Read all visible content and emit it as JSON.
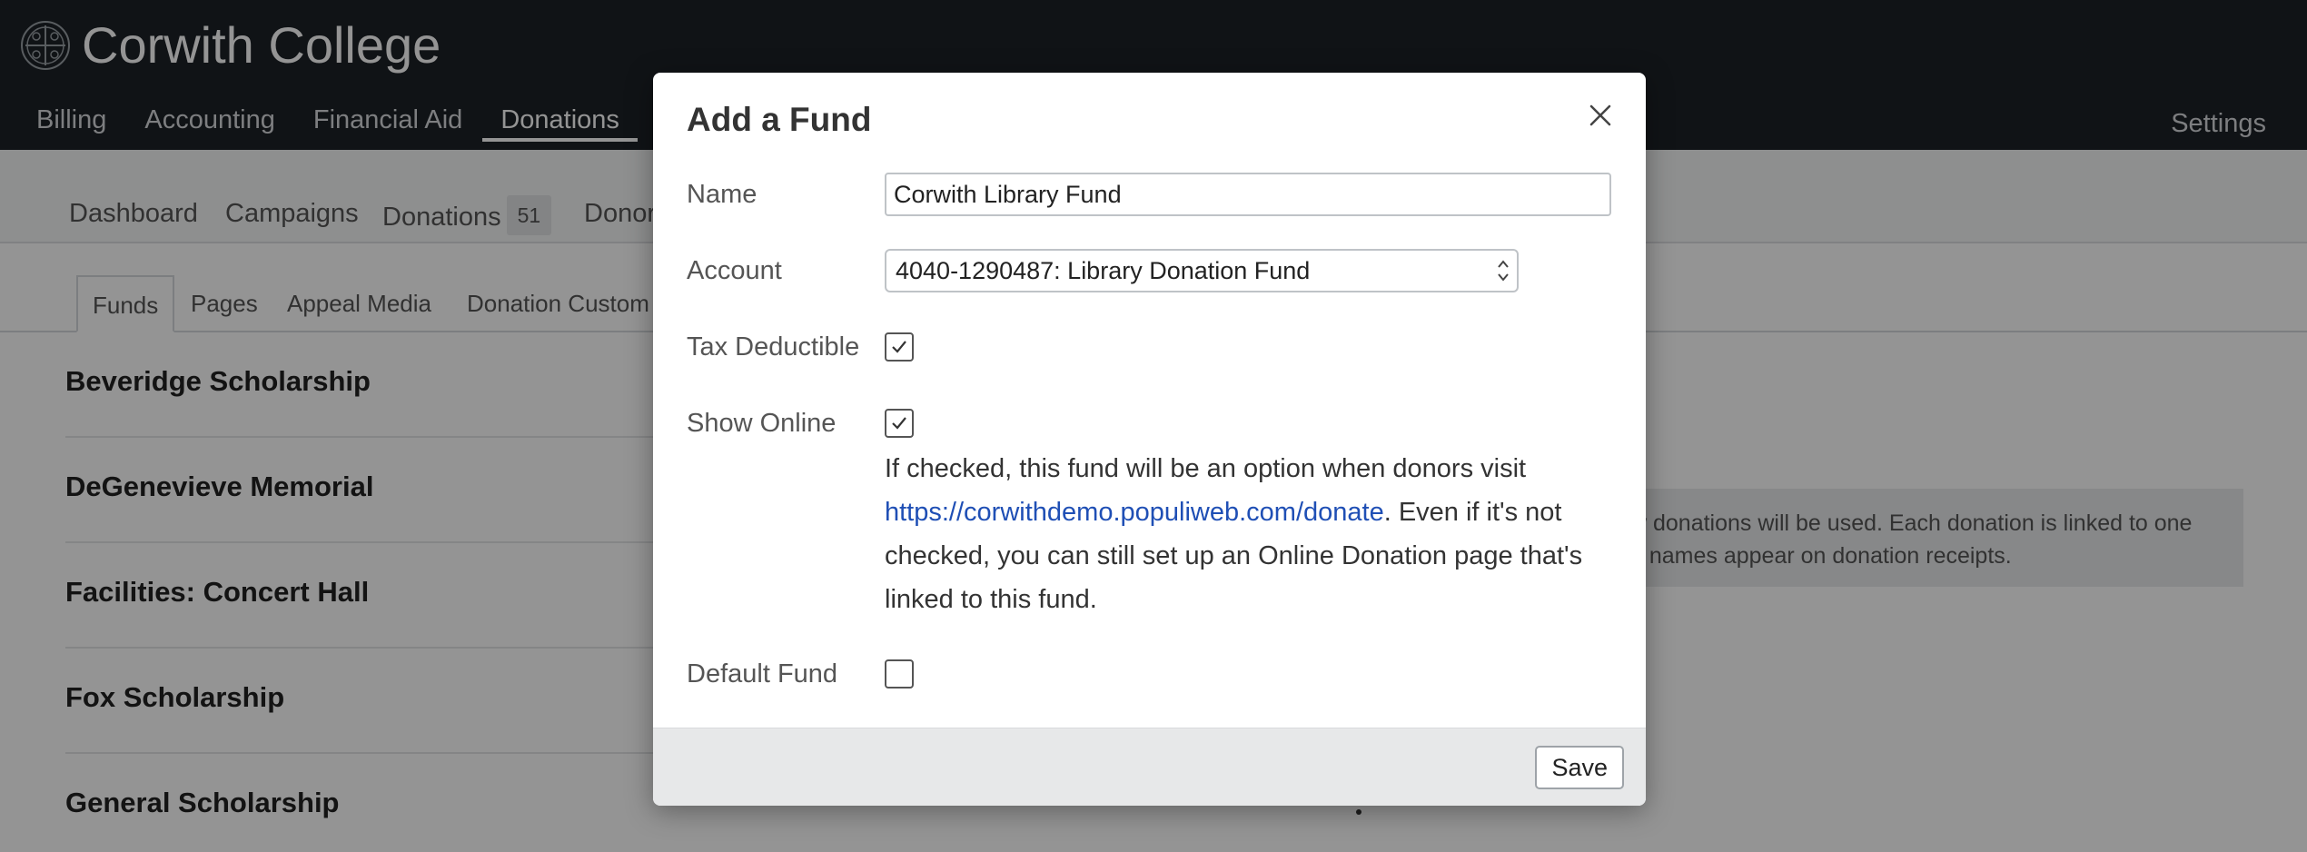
{
  "app": {
    "name": "Corwith College"
  },
  "main_nav": [
    {
      "label": "Billing"
    },
    {
      "label": "Accounting"
    },
    {
      "label": "Financial Aid"
    },
    {
      "label": "Donations"
    }
  ],
  "settings_label": "Settings",
  "sub_nav": [
    {
      "label": "Dashboard"
    },
    {
      "label": "Campaigns"
    },
    {
      "label": "Donations",
      "badge": "51"
    },
    {
      "label": "Donor"
    }
  ],
  "tabs": [
    {
      "label": "Funds"
    },
    {
      "label": "Pages"
    },
    {
      "label": "Appeal Media"
    },
    {
      "label": "Donation Custom"
    }
  ],
  "funds": [
    {
      "name": "Beveridge Scholarship"
    },
    {
      "name": "DeGenevieve Memorial"
    },
    {
      "name": "Facilities: Concert Hall"
    },
    {
      "name": "Fox Scholarship"
    },
    {
      "name": "General Scholarship"
    }
  ],
  "info_box": {
    "line1": "w donations will be used. Each donation is linked to one",
    "line2": "d names appear on donation receipts."
  },
  "modal": {
    "title": "Add a Fund",
    "name_label": "Name",
    "name_value": "Corwith Library Fund",
    "account_label": "Account",
    "account_value": "4040-1290487: Library Donation Fund",
    "tax_label": "Tax Deductible",
    "tax_checked": true,
    "online_label": "Show Online",
    "online_checked": true,
    "help_prefix": "If checked, this fund will be an option when donors visit ",
    "help_link": "https://corwithdemo.populiweb.com/donate",
    "help_suffix": ". Even if it's not checked, you can still set up an Online Donation page that's linked to this fund.",
    "default_label": "Default Fund",
    "default_checked": false,
    "save_label": "Save"
  },
  "colors": {
    "header_bg": "#1c2126",
    "link": "#1f4fb5",
    "footer_bg": "#e7e8e9"
  }
}
